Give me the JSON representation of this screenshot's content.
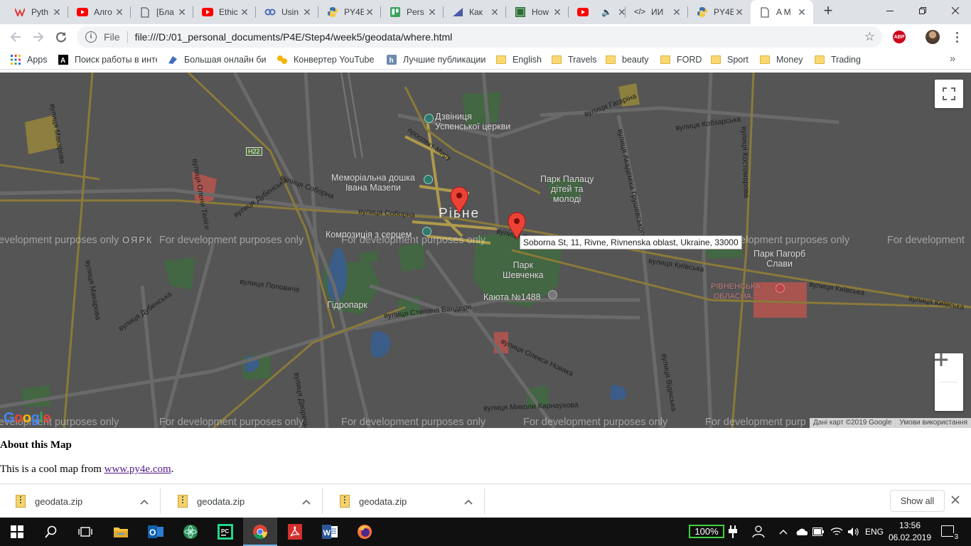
{
  "browser": {
    "tabs": [
      {
        "title": "Pyth",
        "icon": "coursera-icon",
        "active": false
      },
      {
        "title": "Алго",
        "icon": "youtube-icon",
        "active": false
      },
      {
        "title": "[Бла",
        "icon": "document-icon",
        "active": false
      },
      {
        "title": "Ethic",
        "icon": "youtube-icon",
        "active": false
      },
      {
        "title": "Usin",
        "icon": "link-icon",
        "active": false
      },
      {
        "title": "PY4E",
        "icon": "python-icon",
        "active": false
      },
      {
        "title": "Pers",
        "icon": "trello-icon",
        "active": false
      },
      {
        "title": "Как",
        "icon": "bookmark-icon",
        "active": false
      },
      {
        "title": "How",
        "icon": "code-site-icon",
        "active": false
      },
      {
        "title": "",
        "icon": "youtube-audio-icon",
        "active": false
      },
      {
        "title": "ИИ",
        "icon": "code-icon",
        "active": false
      },
      {
        "title": "PY4E",
        "icon": "python-icon",
        "active": false
      },
      {
        "title": "A M",
        "icon": "document-icon",
        "active": true
      }
    ],
    "new_tab_label": "+",
    "address": {
      "scheme": "File",
      "url": "file:///D:/01_personal_documents/P4E/Step4/week5/geodata/where.html"
    },
    "abp_label": "ABP",
    "bookmarks": [
      {
        "label": "Apps",
        "icon": "apps-grid-icon"
      },
      {
        "label": "Поиск работы в инте",
        "icon": "a-logo-icon"
      },
      {
        "label": "Большая онлайн биб",
        "icon": "book-icon"
      },
      {
        "label": "Конвертер YouTube",
        "icon": "converter-icon"
      },
      {
        "label": "Лучшие публикации",
        "icon": "habr-icon"
      },
      {
        "label": "English",
        "icon": "folder-icon"
      },
      {
        "label": "Travels",
        "icon": "folder-icon"
      },
      {
        "label": "beauty",
        "icon": "folder-icon"
      },
      {
        "label": "FORD",
        "icon": "folder-icon"
      },
      {
        "label": "Sport",
        "icon": "folder-icon"
      },
      {
        "label": "Money",
        "icon": "folder-icon"
      },
      {
        "label": "Trading",
        "icon": "folder-icon"
      }
    ],
    "bookmarks_more": "»"
  },
  "map": {
    "watermark": "For development purposes only",
    "watermark_partial_left": "evelopment purposes only",
    "watermark_partial_right": "For development",
    "watermark_partial_bottom_right": "For development purp",
    "city_label": "Рівне",
    "labels": {
      "church": "Дзвіниця\nУспенської церкви",
      "memorial": "Меморіальна дошка\nІвана Мазепи",
      "park_palace": "Парк Палацу\nдітей та\nмолоді",
      "composition": "Композиція з серцем",
      "park_shevchenko": "Парк\nШевченка",
      "kayuta": "Каюта №1488",
      "hydropark": "Гідропарк",
      "park_pagorb": "Парк Пагорб\nСлави",
      "hospital": "РІВНЕНСЬКА\nОБЛАСНА...",
      "district": "ОЯРК",
      "road_badge": "H22"
    },
    "streets": {
      "sobornoi_1": "вулиця Соборна",
      "sobornoi_2": "вулиця Соборна",
      "sobornoi_3": "вулиця С",
      "kyivska_1": "вулиця Київська",
      "kyivska_2": "вулиця Київська",
      "kyivska_3": "вулиця Київська",
      "makarova_1": "вулиця Макарова",
      "makarova_2": "вулиця Макарова",
      "gagarina": "вулиця Гагаріна",
      "kobzarska": "вулиця Кобзарська",
      "kostomarova": "вулиця Костомарова",
      "dubenska_1": "вулиця Дубенська",
      "dubenska_2": "вулиця Дубенська",
      "bandery": "вулиця Степана Бандери",
      "karnaukhova": "вулиця Миколи Карнаухова",
      "olekny": "вулиця Олекси Новака",
      "popovycha": "вулиця Поповича",
      "mira": "проспект Миру",
      "hrushevskoho": "вулиця Академіка Грушевського",
      "teligy": "вулиця Олени Теліги",
      "dvoretska": "вулиця Дворецька",
      "vidinska": "вулиця Відінська"
    },
    "info_window": "Soborna St, 11, Rivne, Rivnenska oblast, Ukraine, 33000",
    "google_logo": "Google",
    "attribution": "Дані карт ©2019 Google",
    "terms": "Умови використання"
  },
  "page": {
    "heading": "About this Map",
    "text_before": "This is a cool map from ",
    "link": "www.py4e.com",
    "text_after": "."
  },
  "downloads": {
    "items": [
      {
        "name": "geodata.zip"
      },
      {
        "name": "geodata.zip"
      },
      {
        "name": "geodata.zip"
      }
    ],
    "show_all": "Show all"
  },
  "taskbar": {
    "battery": "100%",
    "language": "ENG",
    "time": "13:56",
    "date": "06.02.2019",
    "notifications": "3"
  },
  "colors": {
    "map_bg": "#555555",
    "main_road": "#8a7a3a",
    "park": "#3f6b3f",
    "water": "#3b5d8a",
    "marker": "#ea4335"
  }
}
